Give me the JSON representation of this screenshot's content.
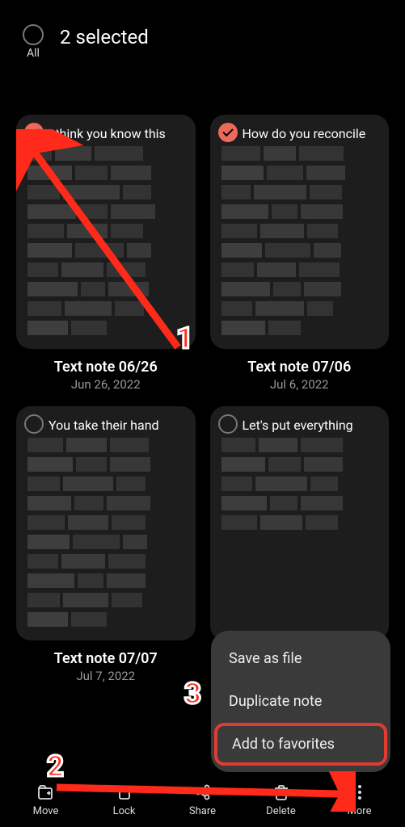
{
  "header": {
    "all_label": "All",
    "selected_text": "2 selected"
  },
  "notes": [
    {
      "preview": "I think you know this",
      "title": "Text note 06/26",
      "date": "Jun 26, 2022",
      "selected": true
    },
    {
      "preview": "How do you reconcile",
      "title": "Text note 07/06",
      "date": "Jul 6, 2022",
      "selected": true
    },
    {
      "preview": "You take their hand",
      "title": "Text note 07/07",
      "date": "Jul 7, 2022",
      "selected": false
    },
    {
      "preview": "Let's put everything",
      "title": "",
      "date": "",
      "selected": false
    }
  ],
  "popup": {
    "items": [
      "Save as file",
      "Duplicate note",
      "Add to favorites"
    ]
  },
  "bottombar": {
    "move": "Move",
    "lock": "Lock",
    "share": "Share",
    "delete": "Delete",
    "more": "More"
  },
  "annotations": {
    "n1": "1",
    "n2": "2",
    "n3": "3"
  }
}
